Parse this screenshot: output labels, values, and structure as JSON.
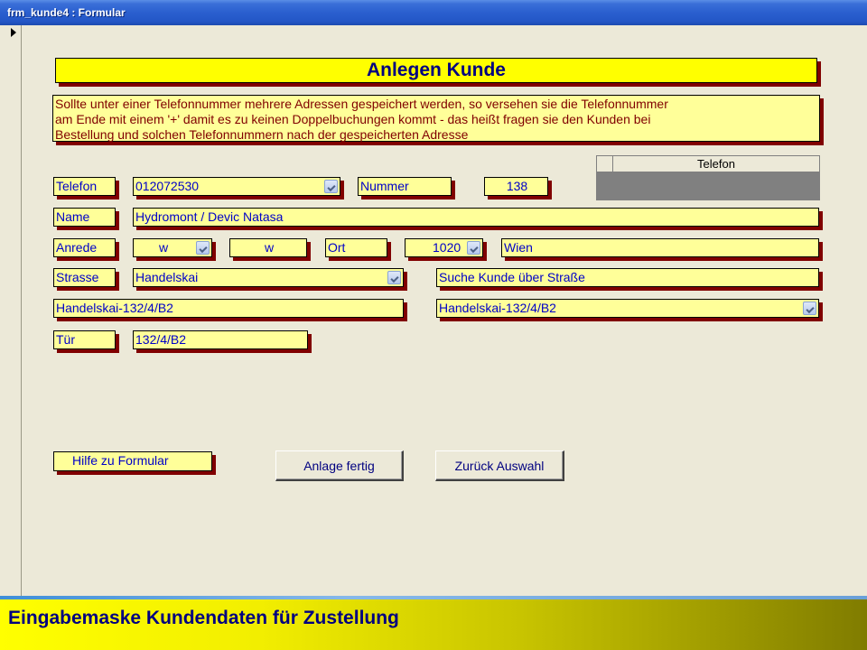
{
  "window": {
    "title": "frm_kunde4 : Formular"
  },
  "form": {
    "heading": "Anlegen Kunde",
    "info_text": "Sollte unter einer Telefonnummer mehrere Adressen gespeichert werden, so versehen sie die Telefonnummer\nam Ende mit einem '+' damit es zu keinen Doppelbuchungen kommt - das heißt fragen sie den Kunden bei\nBestellung und solchen Telefonnummern nach der gespeicherten Adresse",
    "labels": {
      "telefon": "Telefon",
      "nummer": "Nummer",
      "name": "Name",
      "anrede": "Anrede",
      "ort": "Ort",
      "strasse": "Strasse",
      "tuer": "Tür"
    },
    "fields": {
      "telefon": "012072530",
      "nummer": "138",
      "name": "Hydromont / Devic Natasa",
      "anrede": "w",
      "anrede_display": "w",
      "plz": "1020",
      "ort_name": "Wien",
      "strasse": "Handelskai",
      "suche_label": "Suche Kunde über Straße",
      "adresse_full": "Handelskai-132/4/B2",
      "adresse_select": "Handelskai-132/4/B2",
      "tuer": "132/4/B2"
    },
    "subform": {
      "column_header": "Telefon"
    },
    "buttons": {
      "hilfe": "Hilfe zu Formular",
      "anlage_fertig": "Anlage fertig",
      "zurueck": "Zurück Auswahl"
    }
  },
  "caption": {
    "text": "Eingabemaske Kundendaten für Zustellung"
  }
}
